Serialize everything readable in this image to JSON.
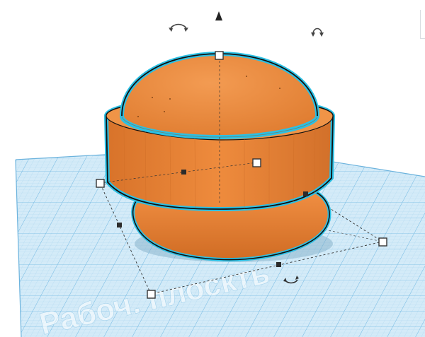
{
  "workplane": {
    "label": "Рабоч. плоскть"
  },
  "colors": {
    "shape_fill": "#ec8a3c",
    "shape_shadow": "#c96a22",
    "shape_outline": "#111111",
    "selection_glow": "#2bc0e4",
    "grid_fill": "#cfe8f6",
    "grid_line": "#8fc7e6",
    "grid_major": "#5aaedc",
    "handle_white": "#ffffff",
    "handle_black": "#2b2b2b"
  },
  "icons": {
    "move_up": "up-arrow-icon",
    "rotate_left": "rotate-arc-icon",
    "rotate_right": "rotate-arc-icon",
    "rotate_bottom": "rotate-arc-icon"
  }
}
